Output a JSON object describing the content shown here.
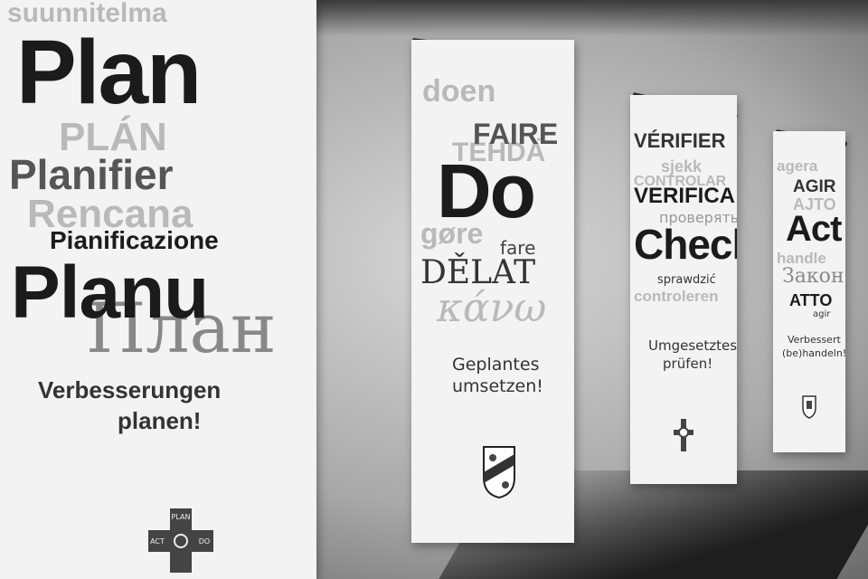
{
  "plan": {
    "words": [
      "suunnitelma",
      "Plan",
      "PLÁN",
      "Planifier",
      "Rencana",
      "Pianificazione",
      "Planu",
      "План"
    ],
    "slogan": [
      "Verbesserungen",
      "planen!"
    ],
    "emblem_labels": [
      "PLAN",
      "ACT",
      "DO"
    ]
  },
  "do": {
    "words": [
      "doen",
      "FAIRE",
      "TEHDÄ",
      "Do",
      "gøre",
      "fare",
      "DĚLAT",
      "κάνω"
    ],
    "slogan": [
      "Geplantes",
      "umsetzen!"
    ]
  },
  "check": {
    "words": [
      "VÉRIFIER",
      "sjekk",
      "CONTROLAR",
      "VERIFICA",
      "проверять",
      "Check",
      "sprawdzić",
      "controleren"
    ],
    "slogan": [
      "Umgesetztes",
      "prüfen!"
    ]
  },
  "act": {
    "words": [
      "agera",
      "AGIR",
      "AJTO",
      "Act",
      "handle",
      "Закон",
      "ATTO",
      "agir"
    ],
    "slogan": [
      "Verbessert",
      "(be)handeln!"
    ]
  }
}
